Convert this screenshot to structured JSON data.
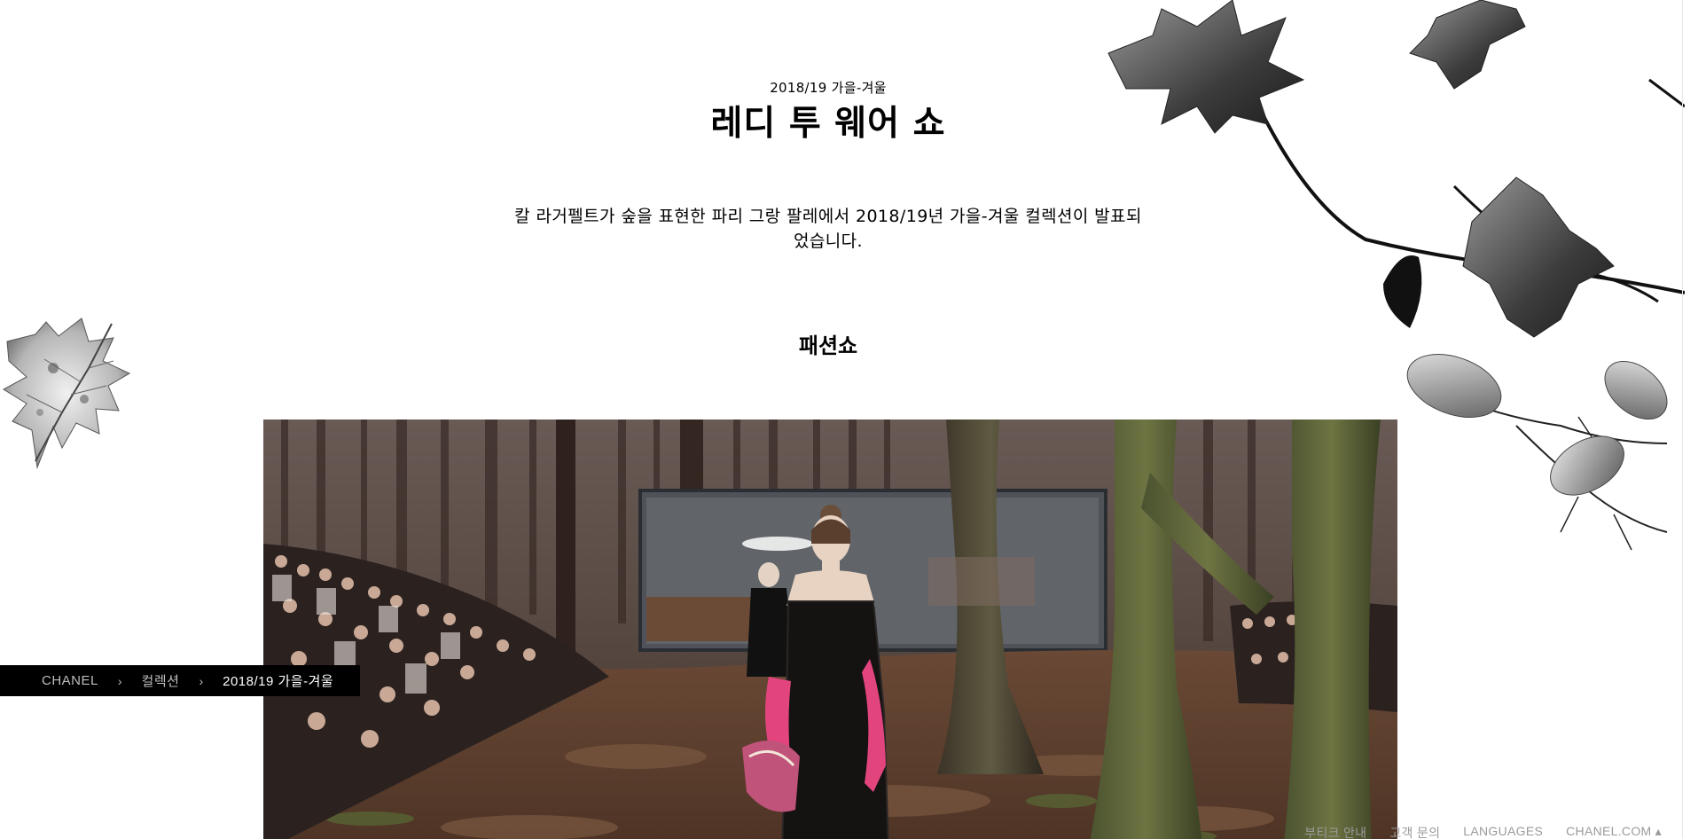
{
  "header": {
    "season": "2018/19 가을-겨울",
    "title": "레디 투 웨어 쇼"
  },
  "intro": {
    "line1": "칼 라거펠트가 숲을 표현한 파리 그랑 팔레에서 2018/19년 가을-겨울 컬렉션이 발표되",
    "line2": "었습니다."
  },
  "section": {
    "heading": "패션쇼"
  },
  "breadcrumb": {
    "items": [
      "CHANEL",
      "컬렉션",
      "2018/19 가을-겨울"
    ],
    "separator": "›"
  },
  "footer": {
    "links": [
      "부티크 안내",
      "고객 문의",
      "LANGUAGES",
      "CHANEL.COM ▴"
    ]
  },
  "colors": {
    "text": "#000000",
    "breadcrumb_bg": "#000000",
    "footer_text": "#9a9a9a",
    "glove_pink": "#e2457e"
  }
}
